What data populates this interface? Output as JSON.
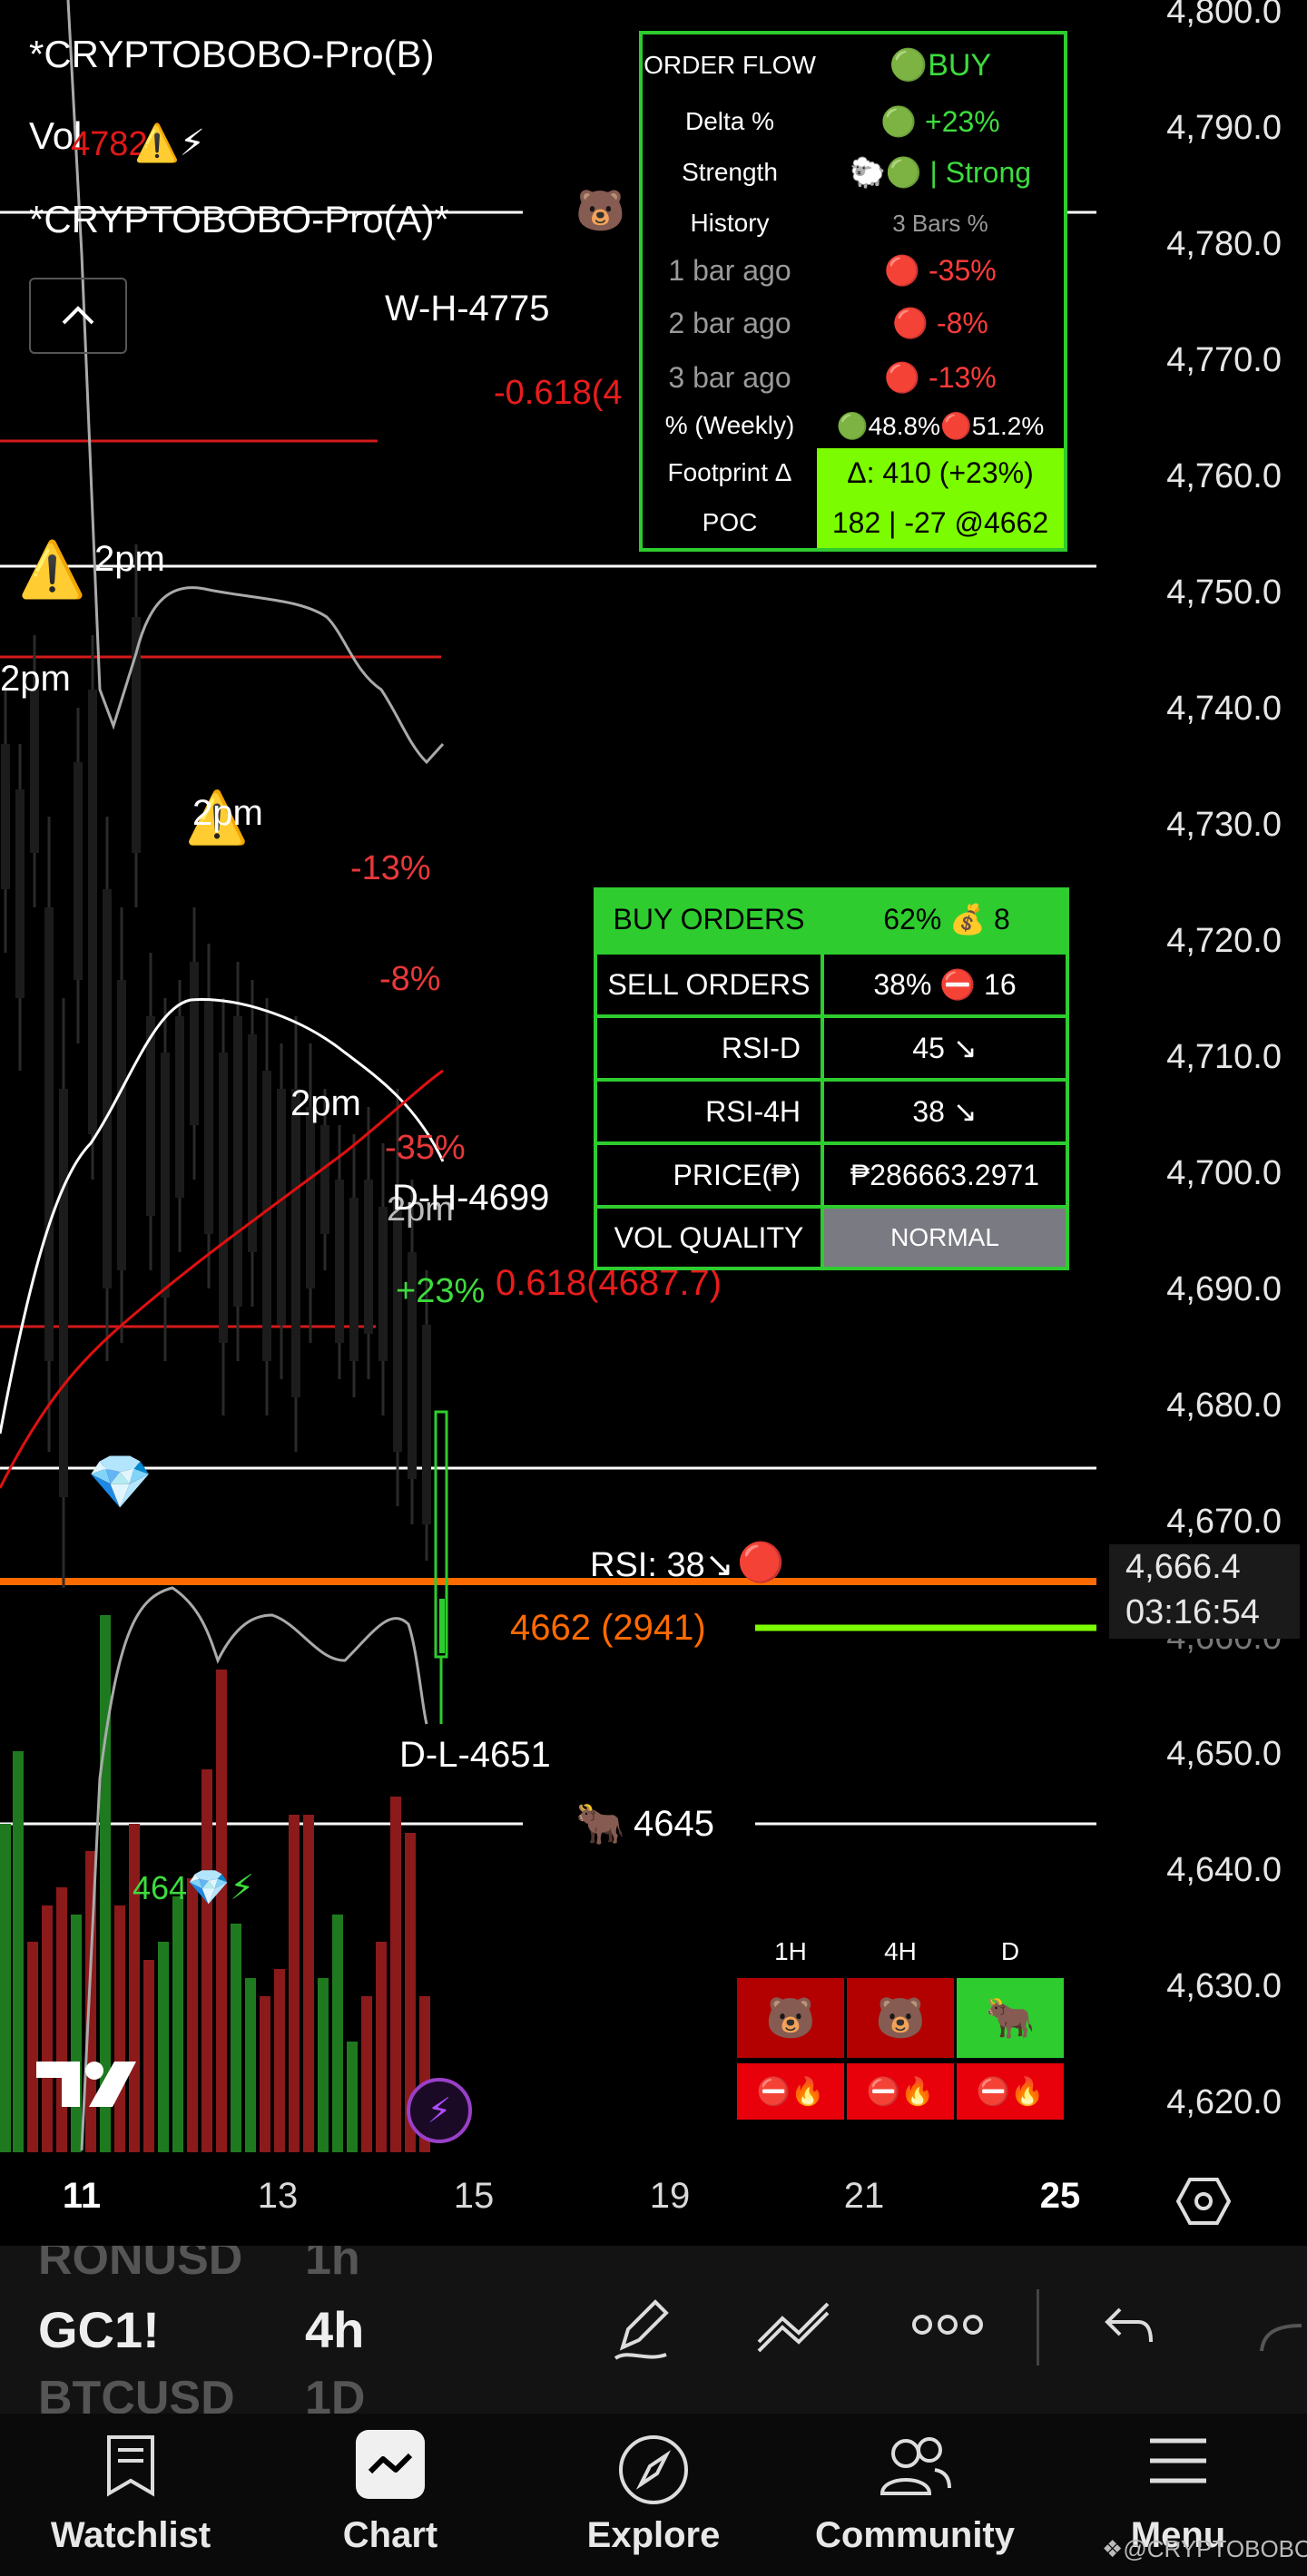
{
  "indicators": {
    "pro_b": "*CRYPTOBOBO-Pro(B)",
    "vol": "Vol",
    "vol_value": "4782",
    "vol_icons": "⚠️⚡",
    "pro_a": "*CRYPTOBOBO-Pro(A)*"
  },
  "price_axis": {
    "ticks": [
      "4,800.0",
      "4,790.0",
      "4,780.0",
      "4,770.0",
      "4,760.0",
      "4,750.0",
      "4,740.0",
      "4,730.0",
      "4,720.0",
      "4,710.0",
      "4,700.0",
      "4,690.0",
      "4,680.0",
      "4,670.0",
      "4,650.0",
      "4,640.0",
      "4,630.0",
      "4,620.0"
    ],
    "current_price": "4,666.4",
    "countdown": "03:16:54",
    "hidden_tick": "4,660.0"
  },
  "time_axis": {
    "ticks": [
      {
        "label": "11",
        "bold": true
      },
      {
        "label": "13",
        "bold": false
      },
      {
        "label": "15",
        "bold": false
      },
      {
        "label": "19",
        "bold": false
      },
      {
        "label": "21",
        "bold": false
      },
      {
        "label": "25",
        "bold": true
      }
    ]
  },
  "chart_labels": {
    "wh": "W-H-4775",
    "fib_top": "-0.618(4",
    "two_pm_1": "2pm",
    "two_pm_2": "2pm",
    "two_pm_3": "2pm",
    "two_pm_4": "2pm",
    "two_pm_5": "2pm",
    "pct_13": "-13%",
    "pct_8": "-8%",
    "pct_35": "-35%",
    "dh": "D-H-4699",
    "pct_23": "+23%",
    "fib_mid": "0.618(4687.7)",
    "rsi": "RSI: 38↘",
    "poc_level": "4662 (2941)",
    "dl": "D-L-4651",
    "bull_level": "4645",
    "vol_label": "464"
  },
  "order_flow": {
    "title": "ORDER FLOW",
    "signal": "BUY",
    "rows": [
      {
        "label": "Delta %",
        "value": "+23%",
        "color": "#3ddc3d"
      },
      {
        "label": "Strength",
        "value": "| Strong",
        "color": "#3ddc3d"
      },
      {
        "label": "History",
        "value": "3 Bars %",
        "color": "#9a9a9a"
      },
      {
        "label": "1 bar ago",
        "value": "-35%",
        "color": "#ff3b3b"
      },
      {
        "label": "2 bar ago",
        "value": "-8%",
        "color": "#ff3b3b"
      },
      {
        "label": "3 bar ago",
        "value": "-13%",
        "color": "#ff3b3b"
      }
    ],
    "weekly_label": "% (Weekly)",
    "weekly_buy": "48.8%",
    "weekly_sell": "51.2%",
    "footprint_label": "Footprint Δ",
    "footprint_value": "Δ: 410 (+23%)",
    "poc_label": "POC",
    "poc_value": "182 | -27 @4662"
  },
  "orders_table": {
    "buy_label": "BUY ORDERS",
    "buy_value": "62% 💰 8",
    "sell_label": "SELL ORDERS",
    "sell_value": "38% ⛔ 16",
    "rsi_d_label": "RSI-D",
    "rsi_d_value": "45 ↘",
    "rsi_4h_label": "RSI-4H",
    "rsi_4h_value": "38 ↘",
    "price_label": "PRICE(₱)",
    "price_value": "₱286663.2971",
    "volq_label": "VOL QUALITY",
    "volq_value": "NORMAL"
  },
  "timeframes": {
    "headers": [
      "1H",
      "4H",
      "D"
    ],
    "trend": [
      "🐻",
      "🐻",
      "🐂"
    ],
    "status": [
      "⛔🔥",
      "⛔🔥",
      "⛔🔥"
    ]
  },
  "symbols": {
    "prev": "RONUSD",
    "prev_tf": "1h",
    "current": "GC1!",
    "current_tf": "4h",
    "next": "BTCUSD",
    "next_tf": "1D"
  },
  "nav": {
    "items": [
      "Watchlist",
      "Chart",
      "Explore",
      "Community",
      "Menu"
    ]
  },
  "watermark": "@CRYPTOBOBO",
  "colors": {
    "up": "#1f7a1f",
    "down": "#8b1a1a",
    "accent_green": "#2ecc2e",
    "orange_line": "#ff6a00",
    "bright_green": "#7cfc00"
  }
}
